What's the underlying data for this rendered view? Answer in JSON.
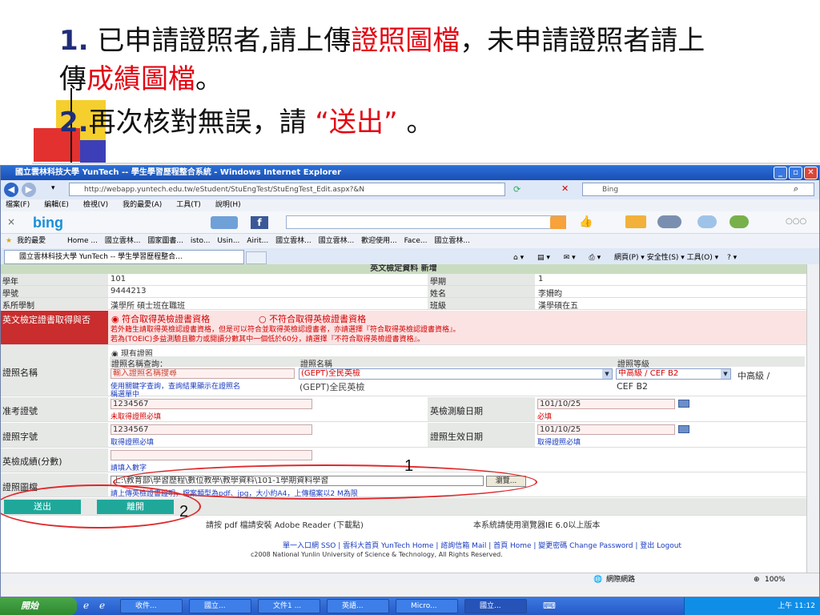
{
  "slide": {
    "line1_num": "1.",
    "line1_text_a": " 已申請證照者,請上傳",
    "line1_red": "證照圖檔",
    "line1_text_b": "，未申請證照者請上",
    "line2_text_a": "傳",
    "line2_red": "成績圖檔",
    "line2_text_b": "。",
    "line3_num": "2.",
    "line3_text_a": "再次核對無誤，請 ",
    "line3_quote_open": "“",
    "line3_red": "送出",
    "line3_quote_close": "”",
    "line3_text_b": "  。"
  },
  "browser": {
    "title": "國立雲林科技大學 YunTech -- 學生學習歷程整合系統 - Windows Internet Explorer",
    "address": "http://webapp.yuntech.edu.tw/eStudent/StuEngTest/StuEngTest_Edit.aspx?&N",
    "search_placeholder": "Bing",
    "menu": [
      "檔案(F)",
      "編輯(E)",
      "檢視(V)",
      "我的最愛(A)",
      "工具(T)",
      "說明(H)"
    ],
    "bing_logo": "bing",
    "favorites": [
      "我的最愛",
      "Home ...",
      "國立雲林...",
      "國家圖書...",
      "isto...",
      "Usin...",
      "Airit...",
      "國立雲林...",
      "國立雲林...",
      "歡迎使用...",
      "Face...",
      "國立雲林..."
    ],
    "tab_title": "國立雲林科技大學 YunTech -- 學生學習歷程整合...",
    "command_bar": "網頁(P) ▾  安全性(S) ▾  工具(O) ▾",
    "status": "網際網路",
    "zoom": "100%"
  },
  "form": {
    "header": "英文檢定資料    新增",
    "labels": {
      "grade": "學年",
      "student_id": "學號",
      "dept": "系所學制",
      "term": "學期",
      "name": "姓名",
      "class": "班級",
      "eligibility": "英文檢定證書取得與否",
      "cert_name": "證照名稱",
      "ticket": "准考證號",
      "exam_date": "英檢測驗日期",
      "cert_no": "證照字號",
      "effective_date": "證照生效日期",
      "score": "英檢成績(分數)",
      "cert_file": "證照圖檔"
    },
    "values": {
      "grade": "101",
      "student_id": "9444213",
      "dept": "漢學所 碩士班在職班",
      "term": "1",
      "name": "李姍昀",
      "class": "漢學碩在五"
    },
    "eligibility": {
      "option_yes": "符合取得英檢證書資格",
      "option_no": "不符合取得英檢證書資格",
      "note1": "若外籍生請取得英檢認證書資格，但是可以符合並取得英檢認證書者，亦請選擇『符合取得英檢認證書資格』。",
      "note2": "若為(TOEIC)多益測驗且聽力或閱讀分數其中一個低於60分，請選擇『不符合取得英檢證書資格』。",
      "has_cert": "現有證照"
    },
    "cert": {
      "col_query": "證照名稱查詢：",
      "col_name": "證照名稱",
      "col_level": "證照等級",
      "query_input": "輸入證照名稱搜尋",
      "name_select": "(GEPT)全民英檢",
      "level_select": "中高級 / CEF B2",
      "level_text": "中高級 /",
      "level_text2": "CEF B2",
      "hint": "使用關鍵字查詢，查詢結果顯示在證照名",
      "hint2": "稱選單中",
      "name_text": "(GEPT)全民英檢"
    },
    "ticket_value": "1234567",
    "ticket_note": "未取得證照必填",
    "exam_date_value": "101/10/25",
    "exam_date_note": "必填",
    "cert_no_value": "1234567",
    "cert_no_note": "取得證照必填",
    "effective_date_value": "101/10/25",
    "effective_date_note": "取得證照必填",
    "score_note": "請填入數字",
    "file_path": "上:\\教育部\\學習歷程\\數位教學\\教學資料\\101-1學期資料學習",
    "browse_label": "瀏覽...",
    "file_note": "請上傳英檢證書證明，檔案類型為pdf、jpg，大小約A4，上傳檔案以2 M為限",
    "send_label": "送出",
    "leave_label": "離開",
    "footer_reader": "請按 pdf 檔請安裝 Adobe Reader (下載點)",
    "footer_browser": "本系統請使用瀏覽器IE 6.0以上版本",
    "footer_links": "單一入口網 SSO | 雲科大首頁 YunTech Home | 諮詢信箱 Mail | 首頁 Home | 變更密碼 Change Password | 登出 Logout",
    "copyright": "c2008 National Yunlin University of Science & Technology, All Rights Reserved."
  },
  "callouts": {
    "one": "1",
    "two": "2"
  },
  "taskbar": {
    "start": "開始",
    "tasks": [
      "收件...",
      "國立...",
      "文件1 ...",
      "英語...",
      "Micro...",
      "國立..."
    ],
    "clock": "上午 11:12"
  },
  "colors": {
    "accent_red": "#e30613",
    "title_blue": "#1f2e7a",
    "button_teal": "#1fa89a"
  }
}
